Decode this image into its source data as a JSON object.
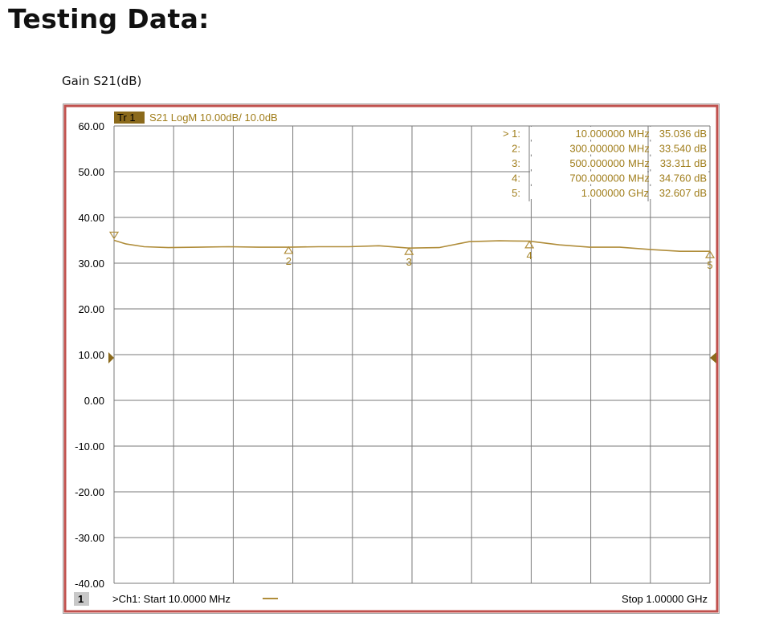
{
  "page": {
    "title": "Testing Data:",
    "caption": "Gain S21(dB)"
  },
  "analyzer": {
    "trace_badge": "Tr 1",
    "trace_info": "S21 LogM 10.00dB/  10.0dB",
    "channel_badge": "1",
    "start_label": ">Ch1: Start  10.0000 MHz",
    "stop_label": "Stop  1.00000 GHz"
  },
  "colors": {
    "trace": "#b08d3a",
    "marker_text": "#a07d1a",
    "badge": "#8b6a1c",
    "grid": "#7a7a7a",
    "frame_outer": "#c0504d",
    "frame_inner": "#9a9a9a"
  },
  "chart_data": {
    "type": "line",
    "xlabel": "",
    "ylabel": "",
    "xlim": [
      10,
      1000
    ],
    "x_unit": "MHz",
    "ylim": [
      -40,
      60
    ],
    "y_ticks": [
      "60.00",
      "50.00",
      "40.00",
      "30.00",
      "20.00",
      "10.00",
      "0.00",
      "-10.00",
      "-20.00",
      "-30.00",
      "-40.00"
    ],
    "grid": true,
    "reference_level": 10.0,
    "series": [
      {
        "x": [
          10,
          30,
          60,
          100,
          150,
          200,
          250,
          300,
          350,
          400,
          450,
          500,
          550,
          600,
          650,
          700,
          750,
          800,
          850,
          900,
          950,
          1000
        ],
        "y": [
          35.0,
          34.2,
          33.6,
          33.4,
          33.5,
          33.6,
          33.5,
          33.5,
          33.6,
          33.6,
          33.8,
          33.3,
          33.4,
          34.7,
          34.9,
          34.8,
          34.0,
          33.5,
          33.5,
          33.0,
          32.6,
          32.6
        ]
      }
    ],
    "markers": [
      {
        "num": "1",
        "label": "> 1:",
        "freq": "10.000000 MHz",
        "value": "35.036 dB",
        "x": 10,
        "y": 35.036
      },
      {
        "num": "2",
        "label": "2:",
        "freq": "300.000000 MHz",
        "value": "33.540 dB",
        "x": 300,
        "y": 33.54
      },
      {
        "num": "3",
        "label": "3:",
        "freq": "500.000000 MHz",
        "value": "33.311 dB",
        "x": 500,
        "y": 33.311
      },
      {
        "num": "4",
        "label": "4:",
        "freq": "700.000000 MHz",
        "value": "34.760 dB",
        "x": 700,
        "y": 34.76
      },
      {
        "num": "5",
        "label": "5:",
        "freq": "1.000000 GHz",
        "value": "32.607 dB",
        "x": 1000,
        "y": 32.607
      }
    ]
  }
}
